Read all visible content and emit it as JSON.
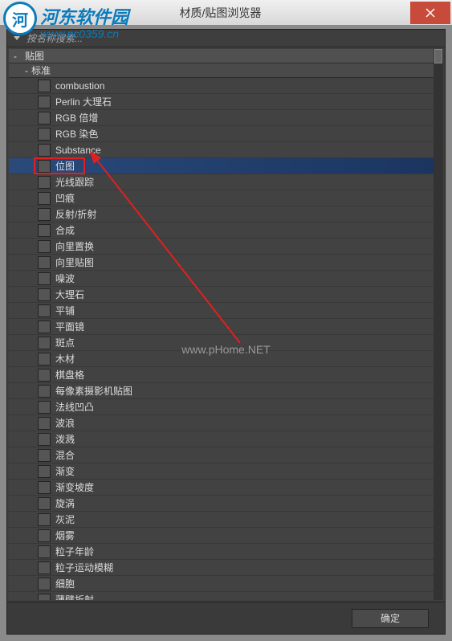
{
  "window": {
    "title": "材质/贴图浏览器"
  },
  "watermark": {
    "logo_text": "河东软件园",
    "logo_url": "www.pc0359.cn",
    "center_text": "www.pHome.NET"
  },
  "search": {
    "placeholder": "按名称搜索..."
  },
  "tree": {
    "root_label": "贴图",
    "category_label": "标准",
    "items": [
      {
        "label": "combustion",
        "swatch": "sw-dark"
      },
      {
        "label": "Perlin 大理石",
        "swatch": "sw-noise"
      },
      {
        "label": "RGB 倍增",
        "swatch": "sw-gray"
      },
      {
        "label": "RGB 染色",
        "swatch": "sw-gray"
      },
      {
        "label": "Substance",
        "swatch": "sw-dark"
      },
      {
        "label": "位图",
        "swatch": "sw-gray",
        "selected": true,
        "highlight": true
      },
      {
        "label": "光线跟踪",
        "swatch": "sw-gray"
      },
      {
        "label": "凹痕",
        "swatch": "sw-noise"
      },
      {
        "label": "反射/折射",
        "swatch": "sw-gray"
      },
      {
        "label": "合成",
        "swatch": "sw-gray"
      },
      {
        "label": "向里置换",
        "swatch": "sw-gray"
      },
      {
        "label": "向里贴图",
        "swatch": "sw-gray"
      },
      {
        "label": "噪波",
        "swatch": "sw-noise"
      },
      {
        "label": "大理石",
        "swatch": "sw-marble"
      },
      {
        "label": "平铺",
        "swatch": "sw-stripe"
      },
      {
        "label": "平面镜",
        "swatch": "sw-gray"
      },
      {
        "label": "斑点",
        "swatch": "sw-grain"
      },
      {
        "label": "木材",
        "swatch": "sw-wood"
      },
      {
        "label": "棋盘格",
        "swatch": "sw-checker"
      },
      {
        "label": "每像素摄影机贴图",
        "swatch": "sw-gray"
      },
      {
        "label": "法线凹凸",
        "swatch": "sw-gray"
      },
      {
        "label": "波浪",
        "swatch": "sw-wave"
      },
      {
        "label": "泼溅",
        "swatch": "sw-grain"
      },
      {
        "label": "混合",
        "swatch": "sw-gray"
      },
      {
        "label": "渐变",
        "swatch": "sw-gray"
      },
      {
        "label": "渐变坡度",
        "swatch": "sw-yellow"
      },
      {
        "label": "旋涡",
        "swatch": "sw-swirl"
      },
      {
        "label": "灰泥",
        "swatch": "sw-grain"
      },
      {
        "label": "烟雾",
        "swatch": "sw-smoke"
      },
      {
        "label": "粒子年龄",
        "swatch": "sw-gray"
      },
      {
        "label": "粒子运动模糊",
        "swatch": "sw-gray"
      },
      {
        "label": "细胞",
        "swatch": "sw-cells"
      },
      {
        "label": "薄壁折射",
        "swatch": "sw-gray"
      }
    ]
  },
  "footer": {
    "ok_label": "确定"
  }
}
